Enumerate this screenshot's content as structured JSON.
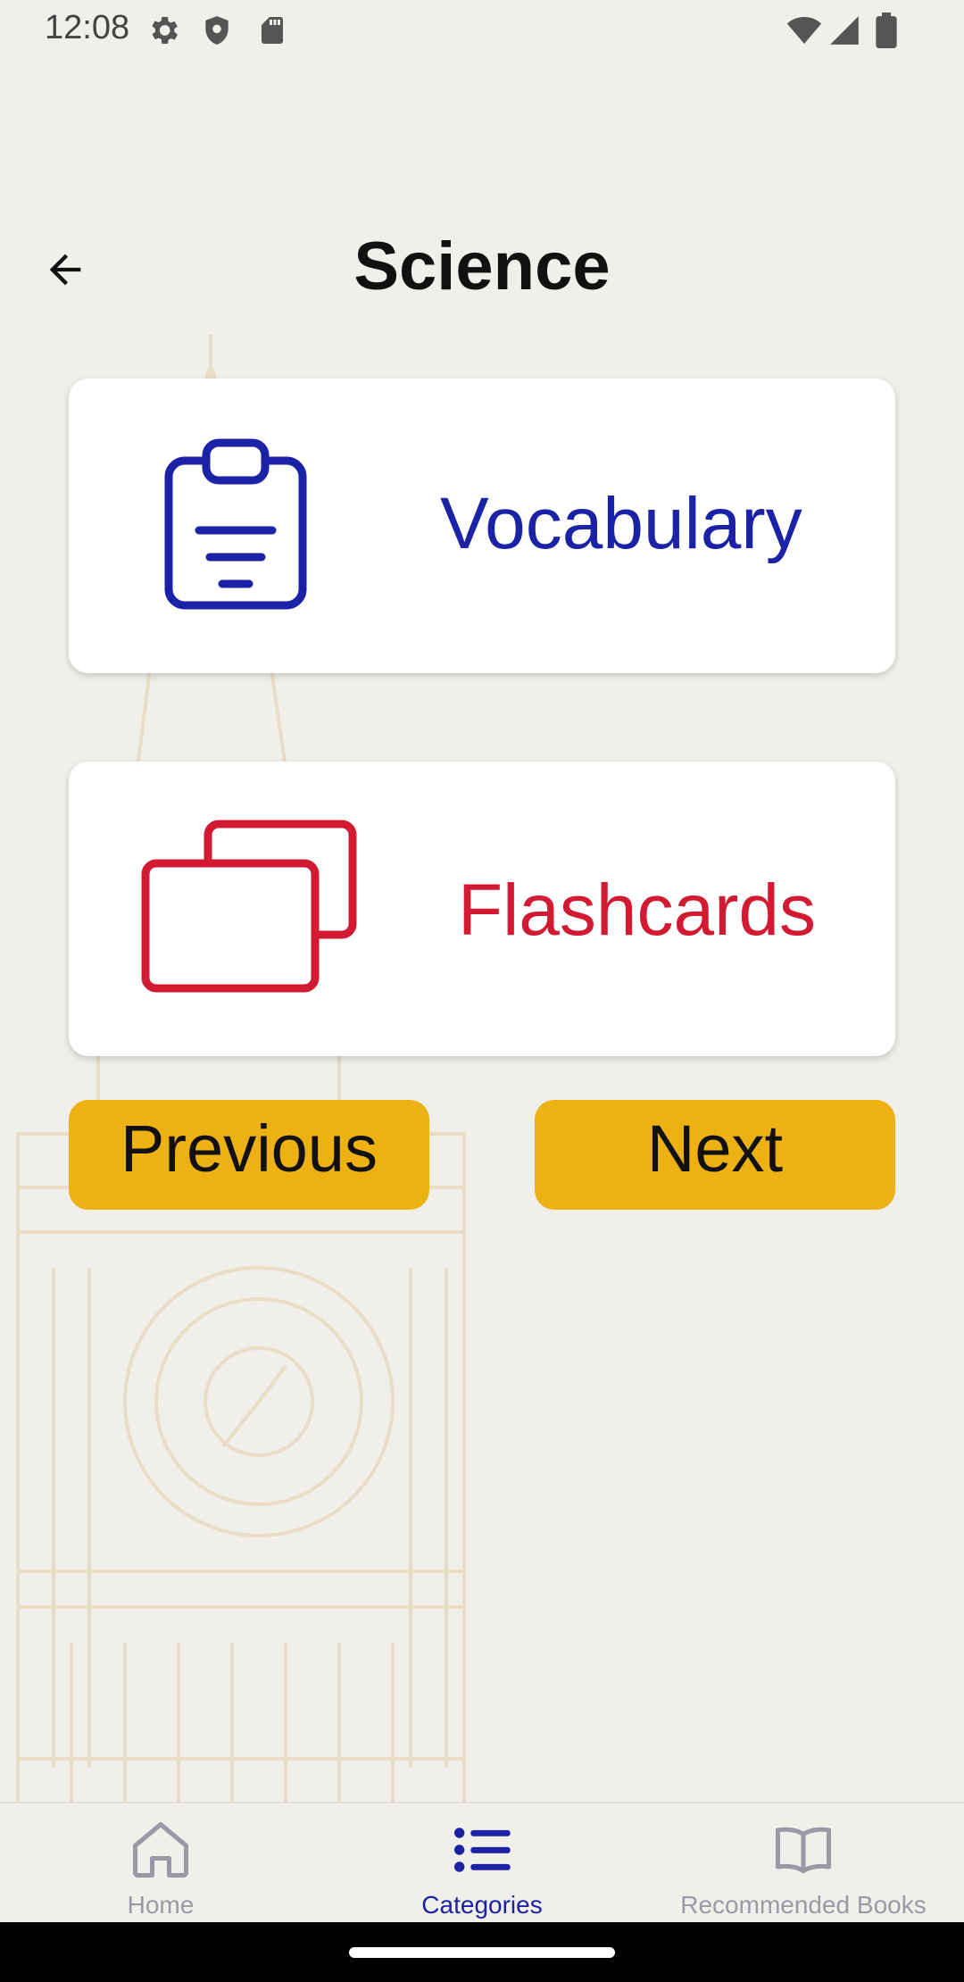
{
  "status_bar": {
    "time": "12:08"
  },
  "header": {
    "title": "Science"
  },
  "cards": [
    {
      "label": "Vocabulary",
      "color": "#1B22A6",
      "icon": "clipboard-list-icon"
    },
    {
      "label": "Flashcards",
      "color": "#D21A33",
      "icon": "flashcards-icon"
    }
  ],
  "buttons": {
    "previous_label": "Previous",
    "next_label": "Next",
    "color": "#EEB114"
  },
  "bottom_nav": {
    "items": [
      {
        "label": "Home",
        "icon": "home-icon",
        "active": false
      },
      {
        "label": "Categories",
        "icon": "list-icon",
        "active": true
      },
      {
        "label": "Recommended Books",
        "icon": "book-icon",
        "active": false
      }
    ],
    "active_color": "#1B22A6",
    "inactive_color": "#8A8A8F"
  }
}
